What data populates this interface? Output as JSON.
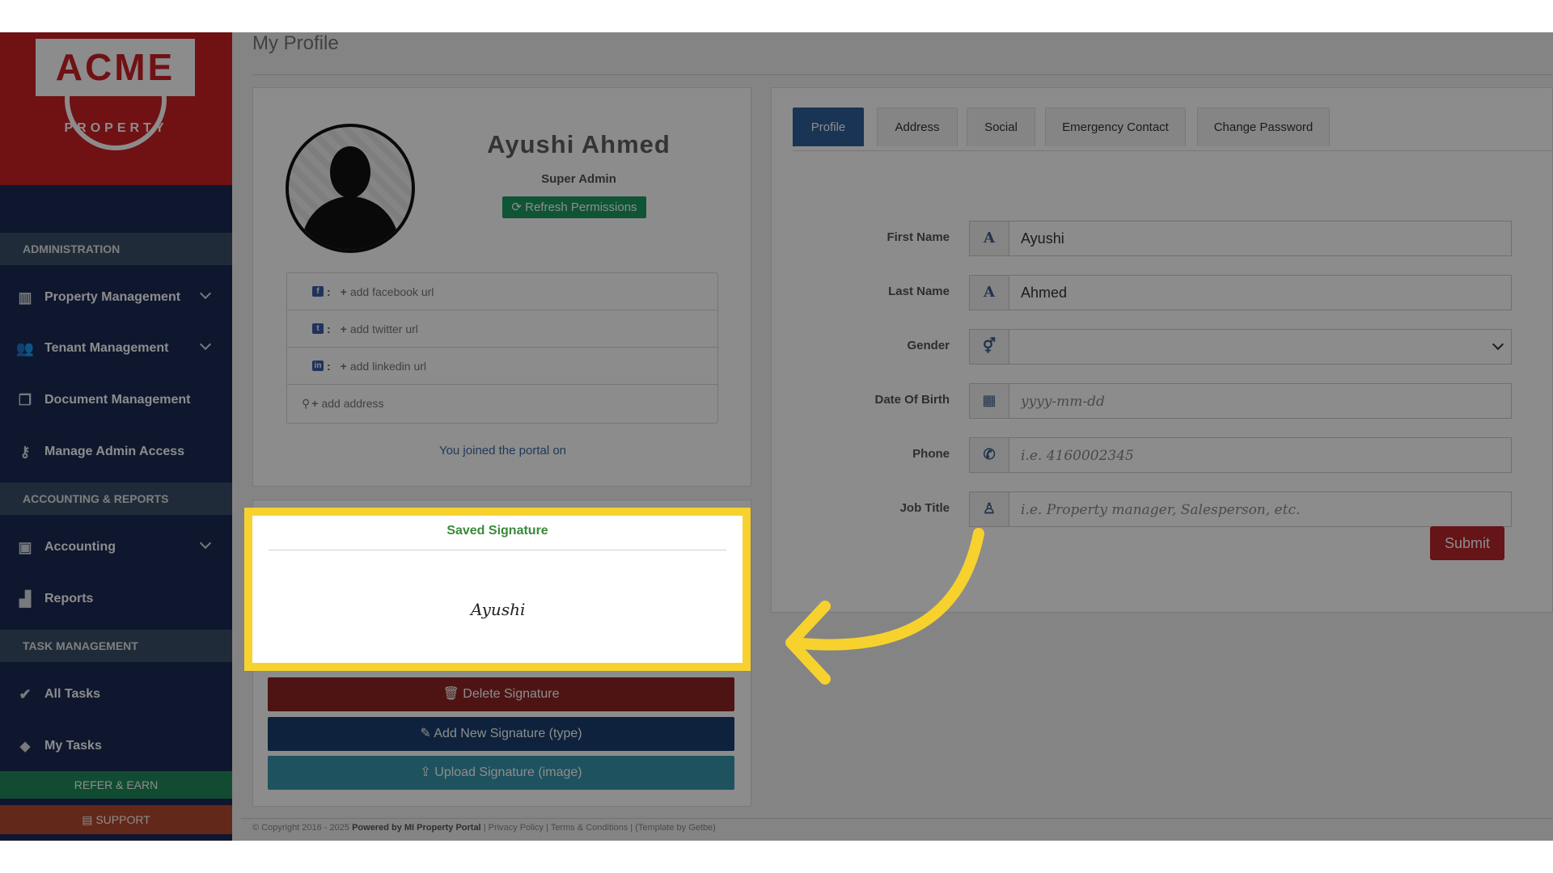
{
  "brand": {
    "logo_text": "ACME",
    "logo_sub": "PROPERTY",
    "primary": "#cc1f26"
  },
  "sidebar": {
    "sections": {
      "administration": "ADMINISTRATION",
      "accounting": "ACCOUNTING & REPORTS",
      "tasks": "TASK MANAGEMENT"
    },
    "items": [
      {
        "label": "Property Management",
        "icon": "building-icon"
      },
      {
        "label": "Tenant Management",
        "icon": "users-icon"
      },
      {
        "label": "Document Management",
        "icon": "documents-icon"
      },
      {
        "label": "Manage Admin Access",
        "icon": "key-icon"
      },
      {
        "label": "Accounting",
        "icon": "money-icon"
      },
      {
        "label": "Reports",
        "icon": "bar-chart-icon"
      },
      {
        "label": "All Tasks",
        "icon": "check-icon"
      },
      {
        "label": "My Tasks",
        "icon": "tag-icon"
      }
    ],
    "refer": "REFER & EARN",
    "support": "SUPPORT"
  },
  "page_title": "My Profile",
  "profile": {
    "name": "Ayushi Ahmed",
    "role": "Super Admin",
    "refresh_label": "Refresh Permissions",
    "social": [
      {
        "label": "add facebook url",
        "icon": "facebook-icon",
        "glyph": "f"
      },
      {
        "label": "add twitter url",
        "icon": "twitter-icon",
        "glyph": "t"
      },
      {
        "label": "add linkedin url",
        "icon": "linkedin-icon",
        "glyph": "in"
      }
    ],
    "address_label": "add address",
    "joined": "You joined the portal on"
  },
  "signature": {
    "title": "Saved Signature",
    "image_text": "Ayushi",
    "delete_label": "Delete Signature",
    "add_label": "Add New Signature (type)",
    "upload_label": "Upload Signature (image)"
  },
  "tabs": [
    "Profile",
    "Address",
    "Social",
    "Emergency Contact",
    "Change Password"
  ],
  "form": {
    "first_name": {
      "label": "First Name",
      "value": "Ayushi"
    },
    "last_name": {
      "label": "Last Name",
      "value": "Ahmed"
    },
    "gender": {
      "label": "Gender",
      "value": ""
    },
    "dob": {
      "label": "Date Of Birth",
      "placeholder": "yyyy-mm-dd"
    },
    "phone": {
      "label": "Phone",
      "placeholder": "i.e. 4160002345"
    },
    "job_title": {
      "label": "Job Title",
      "placeholder": "i.e. Property manager, Salesperson, etc."
    },
    "submit_label": "Submit"
  },
  "footer": {
    "copyright": "© Copyright 2016 - 2025",
    "powered": "Powered by MI Property Portal",
    "links": "| Privacy Policy | Terms & Conditions |",
    "template": "(Template by Getbe)"
  },
  "highlight_color": "#f7d22e"
}
